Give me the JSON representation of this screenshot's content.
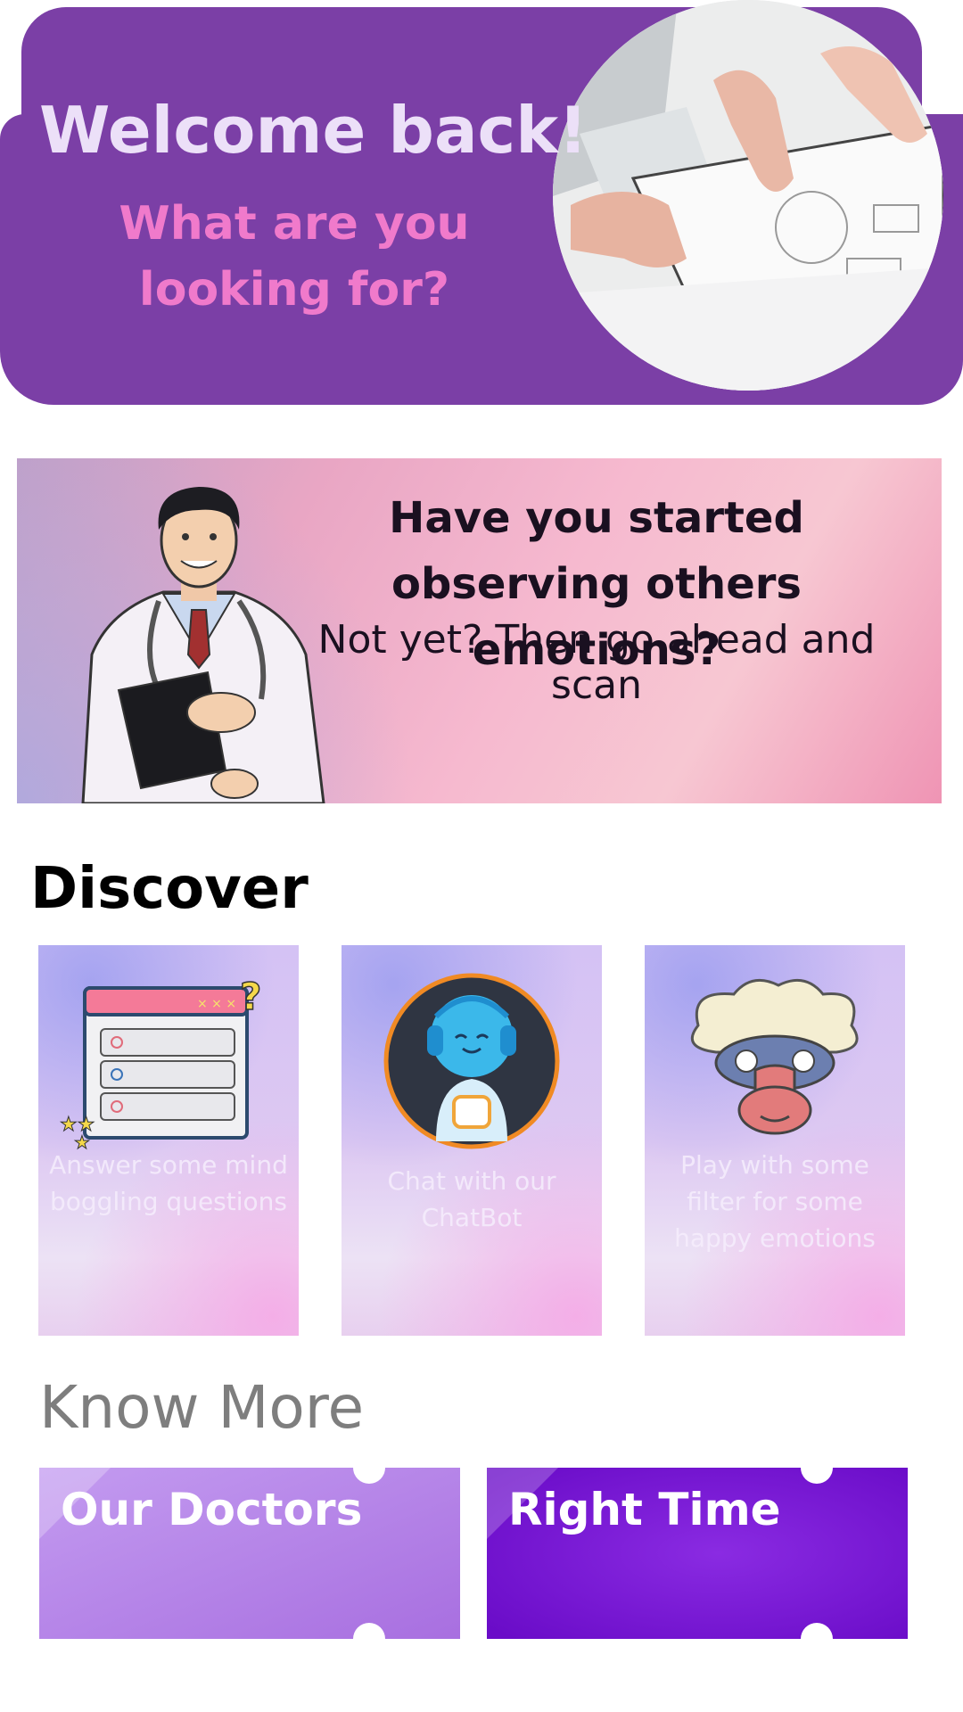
{
  "header": {
    "title": "Welcome back!",
    "subtitle": "What are you looking for?",
    "photo_icon": "hands-on-documents-photo"
  },
  "banner": {
    "heading": "Have you started observing others emotions?",
    "subtext": "Not yet? Then go ahead and scan",
    "illustration": "doctor-illustration"
  },
  "discover": {
    "title": "Discover",
    "cards": [
      {
        "icon": "questionnaire-icon",
        "label": "Answer some mind boggling questions"
      },
      {
        "icon": "chatbot-robot-icon",
        "label": "Chat with our ChatBot"
      },
      {
        "icon": "monkey-face-icon",
        "label": "Play with some filter for some happy emotions"
      }
    ]
  },
  "know_more": {
    "title": "Know More",
    "items": [
      {
        "label": "Our Doctors",
        "color": "#b78ae8"
      },
      {
        "label": "Right Time",
        "color": "#7a12d6"
      }
    ]
  },
  "colors": {
    "header_bg": "#7b3fa6",
    "header_title": "#ece0f8",
    "header_subtitle": "#f07acb"
  }
}
